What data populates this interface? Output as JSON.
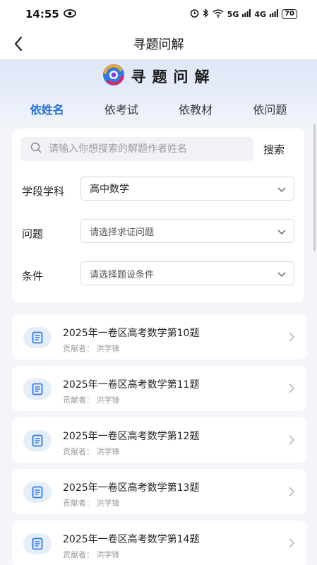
{
  "status": {
    "time": "14:55",
    "signal1": "5G",
    "signal2": "4G",
    "battery": "70"
  },
  "nav": {
    "title": "寻题问解"
  },
  "brand": {
    "name": "寻题问解"
  },
  "tabs": [
    {
      "label": "依姓名",
      "active": true
    },
    {
      "label": "依考试",
      "active": false
    },
    {
      "label": "依教材",
      "active": false
    },
    {
      "label": "依问题",
      "active": false
    }
  ],
  "search": {
    "placeholder": "请输入你想搜索的解题作者姓名",
    "button": "搜索"
  },
  "filters": {
    "subject_label": "学段学科",
    "subject_value": "高中数学",
    "question_label": "问题",
    "question_placeholder": "请选择求证问题",
    "condition_label": "条件",
    "condition_placeholder": "请选择题设条件"
  },
  "items": [
    {
      "title": "2025年一卷区高考数学第10题",
      "contributor": "贡献者：  洪学锋"
    },
    {
      "title": "2025年一卷区高考数学第11题",
      "contributor": "贡献者：  洪学锋"
    },
    {
      "title": "2025年一卷区高考数学第12题",
      "contributor": "贡献者：  洪学锋"
    },
    {
      "title": "2025年一卷区高考数学第13题",
      "contributor": "贡献者：  洪学锋"
    },
    {
      "title": "2025年一卷区高考数学第14题",
      "contributor": "贡献者：  洪学锋"
    }
  ],
  "colors": {
    "accent": "#1f6fe0",
    "icon_bg": "#e6eef9",
    "page_bg": "#f3f5f9"
  }
}
